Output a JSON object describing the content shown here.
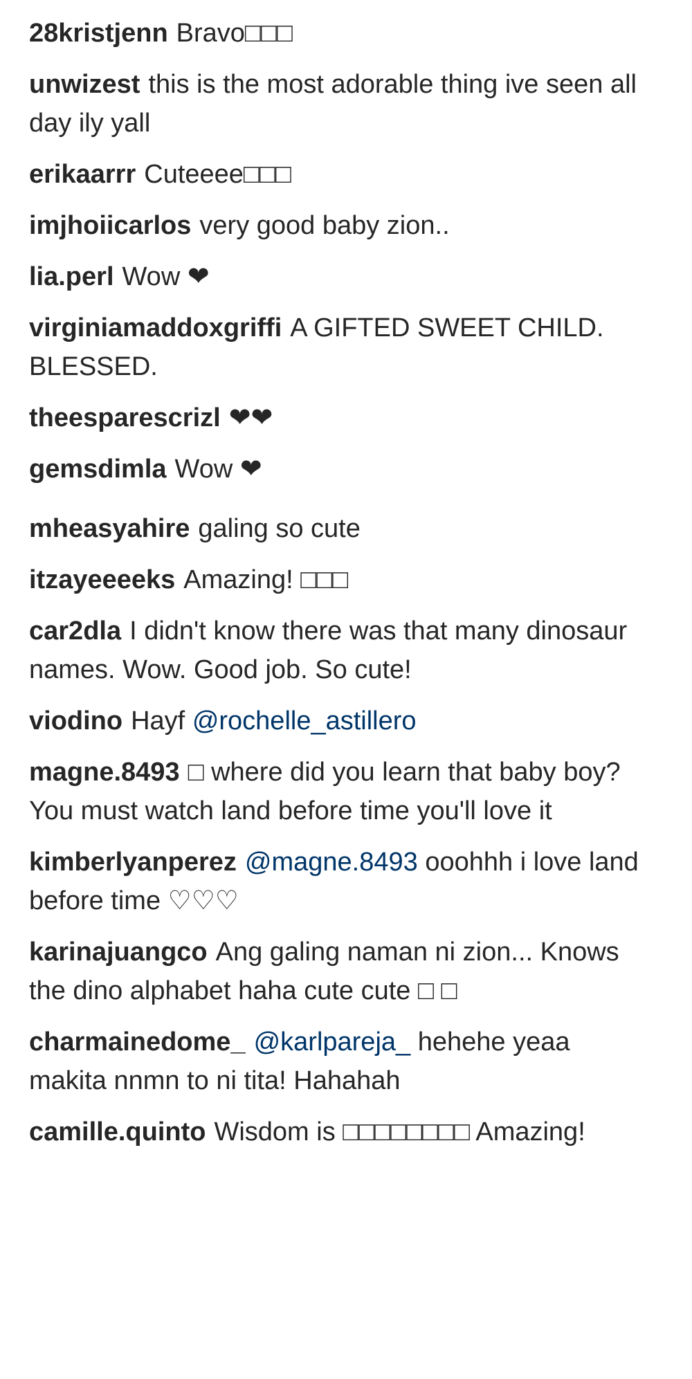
{
  "comments": [
    {
      "username": "28kristjenn",
      "text": "Bravo□□□"
    },
    {
      "username": "unwizest",
      "text": "this is the most adorable thing ive seen all day ily yall"
    },
    {
      "username": "erikaarrr",
      "text": "Cuteeee□□□"
    },
    {
      "username": "imjhoiicarlos",
      "text": "very good baby zion.."
    },
    {
      "username": "lia.perl",
      "text": "Wow ❤"
    },
    {
      "username": "virginiamaddoxgriffi",
      "text": "A GIFTED SWEET CHILD. BLESSED."
    },
    {
      "username": "theesparescrizl",
      "text": "❤❤"
    },
    {
      "username": "gemsdimla",
      "text": "Wow ❤"
    },
    {
      "username": "mheasyahire",
      "text": "galing so cute"
    },
    {
      "username": "itzayeeeeks",
      "text": "Amazing! □□□"
    },
    {
      "username": "car2dla",
      "text": "I didn't know there was that many dinosaur names. Wow. Good job. So cute!"
    },
    {
      "username": "viodino",
      "text": "Hayf",
      "mention": "@rochelle_astillero"
    },
    {
      "username": "magne.8493",
      "text": "□ where did you learn that baby boy? You must watch land before time you'll love it"
    },
    {
      "username": "kimberlyanperez",
      "mention": "@magne.8493",
      "text": "ooohhh i love land before time ♡♡♡"
    },
    {
      "username": "karinajuangco",
      "text": "Ang galing naman ni zion... Knows the dino alphabet haha cute cute □ □"
    },
    {
      "username": "charmainedome_",
      "mention": "@karlpareja_",
      "text": "hehehe yeaa makita nnmn to ni tita! Hahahah"
    },
    {
      "username": "camille.quinto",
      "text": "Wisdom is □□□□□□□□ Amazing!"
    }
  ]
}
